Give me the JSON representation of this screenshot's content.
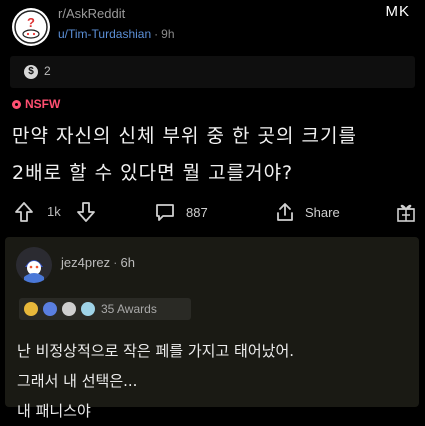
{
  "watermark": "MK",
  "post": {
    "subreddit": "r/AskReddit",
    "author": "u/Tim-Turdashian",
    "separator": "·",
    "age": "9h",
    "award_count": "2",
    "nsfw_label": "NSFW",
    "title_line1": "만약 자신의 신체 부위 중 한 곳의 크기를",
    "title_line2": "2배로 할 수 있다면 뭘 고를거야?",
    "upvotes": "1k",
    "comments": "887",
    "share_label": "Share"
  },
  "comment": {
    "author": "jez4prez",
    "separator": "·",
    "age": "6h",
    "awards_label": "35 Awards",
    "line1": "난 비정상적으로 작은 페를 가지고 태어났어.",
    "line2": "그래서 내 선택은...",
    "line3": "내 패니스야"
  },
  "colors": {
    "background": "#000000",
    "username": "#5b8fd6",
    "nsfw": "#ff4f71",
    "comment_bg": "#1a1a14"
  },
  "icons": [
    "reddit-snoo-icon",
    "award-icon",
    "nsfw-icon",
    "upvote-icon",
    "downvote-icon",
    "comment-icon",
    "share-icon",
    "gift-icon"
  ]
}
